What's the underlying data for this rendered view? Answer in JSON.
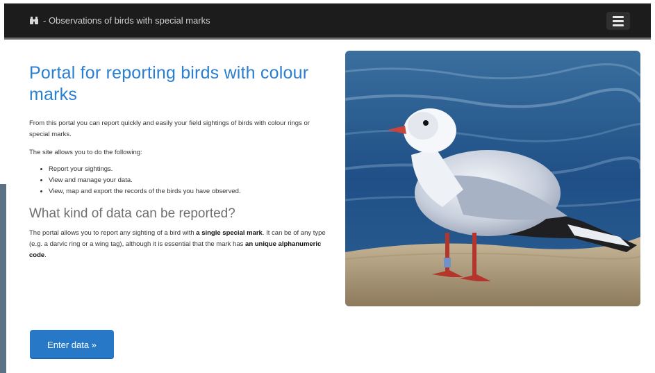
{
  "navbar": {
    "brand_text": "- Observations of birds with special marks",
    "brand_icon": "binoculars-icon",
    "menu_icon": "hamburger-menu-icon"
  },
  "main": {
    "title": "Portal for reporting birds with colour marks",
    "intro": "From this portal you can report quickly and easily your field sightings of birds with colour rings or special marks.",
    "allows": "The site allows you to do the following:",
    "list": [
      "Report your sightings.",
      "View and manage your data.",
      "View, map and export the records of the birds you have observed."
    ],
    "subtitle": "What kind of data can be reported?",
    "desc": {
      "part1": "The portal allows you to report any sighting of a bird with ",
      "bold1": "a single special mark",
      "part2": ". It can be of any type (e.g. a darvic ring or a wing tag), although it is essential that the mark has ",
      "bold2": "an unique alphanumeric code",
      "part3": "."
    },
    "enter_button": "Enter data »"
  },
  "colors": {
    "navbar_bg": "#1c1c1c",
    "title": "#2a7fd0",
    "button": "#2878c8"
  }
}
